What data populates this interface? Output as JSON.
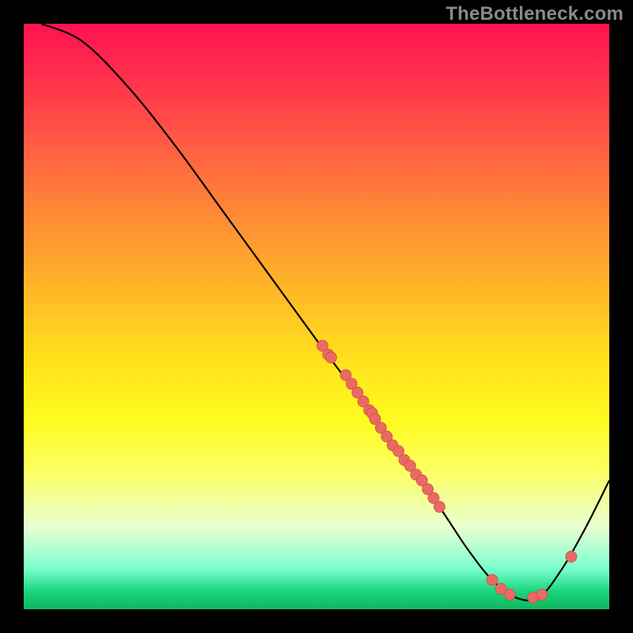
{
  "watermark": "TheBottleneck.com",
  "colors": {
    "curve": "#000000",
    "dot_fill": "#ea6a63",
    "dot_stroke": "#c94f48",
    "background": "#000000"
  },
  "chart_data": {
    "type": "line",
    "title": "",
    "xlabel": "",
    "ylabel": "",
    "xlim": [
      0,
      100
    ],
    "ylim": [
      0,
      100
    ],
    "series": [
      {
        "name": "curve",
        "x": [
          3,
          10,
          18,
          26,
          34,
          42,
          50,
          56,
          62,
          68,
          72,
          76,
          80,
          84,
          88,
          92,
          96,
          100
        ],
        "y": [
          100,
          97,
          89,
          79,
          68,
          57,
          46,
          38,
          30,
          22,
          16,
          10,
          5,
          2,
          2,
          7,
          14,
          22
        ]
      }
    ],
    "dots": [
      {
        "x": 51,
        "y": 45
      },
      {
        "x": 52,
        "y": 43.5
      },
      {
        "x": 52.5,
        "y": 43
      },
      {
        "x": 55,
        "y": 40
      },
      {
        "x": 56,
        "y": 38.5
      },
      {
        "x": 57,
        "y": 37
      },
      {
        "x": 58,
        "y": 35.5
      },
      {
        "x": 59,
        "y": 34
      },
      {
        "x": 59.5,
        "y": 33.5
      },
      {
        "x": 60,
        "y": 32.5
      },
      {
        "x": 61,
        "y": 31
      },
      {
        "x": 62,
        "y": 29.5
      },
      {
        "x": 63,
        "y": 28
      },
      {
        "x": 64,
        "y": 27
      },
      {
        "x": 65,
        "y": 25.5
      },
      {
        "x": 66,
        "y": 24.5
      },
      {
        "x": 67,
        "y": 23
      },
      {
        "x": 68,
        "y": 22
      },
      {
        "x": 69,
        "y": 20.5
      },
      {
        "x": 70,
        "y": 19
      },
      {
        "x": 71,
        "y": 17.5
      },
      {
        "x": 80,
        "y": 5
      },
      {
        "x": 81.5,
        "y": 3.5
      },
      {
        "x": 83,
        "y": 2.5
      },
      {
        "x": 87,
        "y": 2
      },
      {
        "x": 88.5,
        "y": 2.5
      },
      {
        "x": 93.5,
        "y": 9
      }
    ],
    "dot_radius": 7
  }
}
